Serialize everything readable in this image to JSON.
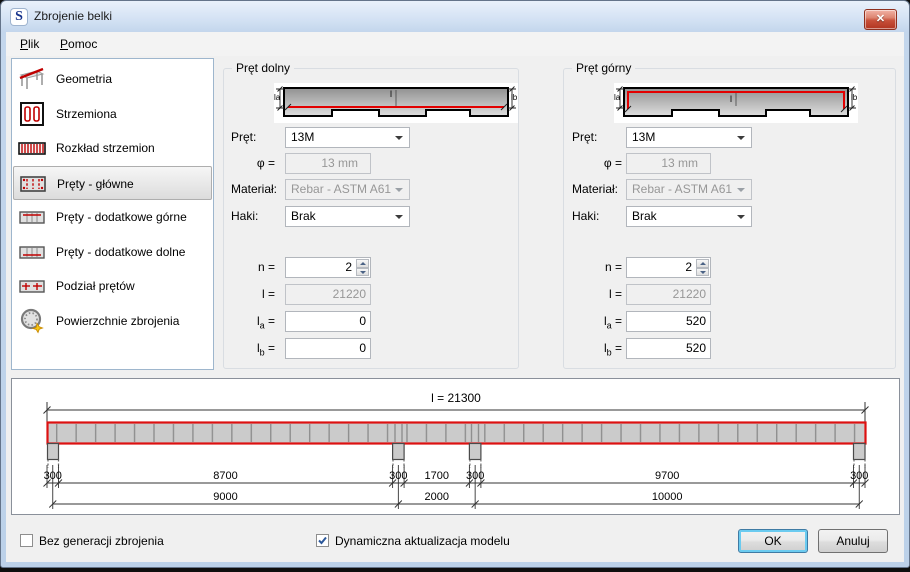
{
  "window": {
    "title": "Zbrojenie belki",
    "app_icon": "S",
    "close_glyph": "✕"
  },
  "menu": {
    "items": [
      {
        "accel": "P",
        "rest": "lik"
      },
      {
        "accel": "P",
        "rest": "omoc"
      }
    ]
  },
  "sidebar": {
    "items": [
      {
        "label": "Geometria",
        "icon": "geometry-icon",
        "selected": false
      },
      {
        "label": "Strzemiona",
        "icon": "stirrups-icon",
        "selected": false
      },
      {
        "label": "Rozkład strzemion",
        "icon": "stirrup-distribution-icon",
        "selected": false
      },
      {
        "label": "Pręty - główne",
        "icon": "main-bars-icon",
        "selected": true
      },
      {
        "label": "Pręty - dodatkowe górne",
        "icon": "additional-top-bars-icon",
        "selected": false
      },
      {
        "label": "Pręty - dodatkowe dolne",
        "icon": "additional-bottom-bars-icon",
        "selected": false
      },
      {
        "label": "Podział prętów",
        "icon": "bar-division-icon",
        "selected": false
      },
      {
        "label": "Powierzchnie zbrojenia",
        "icon": "reinforcement-surfaces-icon",
        "selected": false
      }
    ]
  },
  "groups": {
    "bottom": {
      "title": "Pręt dolny",
      "diagram": {
        "l": "l",
        "la": "la",
        "lb": "lb"
      },
      "rows": {
        "pret_label": "Pręt:",
        "pret_value": "13M",
        "phi_label": "φ =",
        "phi_value": "13 mm",
        "material_label": "Materiał:",
        "material_value": "Rebar - ASTM A61",
        "haki_label": "Haki:",
        "haki_value": "Brak",
        "n_label": "n =",
        "n_value": "2",
        "l_label": "l =",
        "l_value": "21220",
        "la_sym": "l",
        "la_sub": "a",
        "la_eq": "=",
        "la_value": "0",
        "lb_sym": "l",
        "lb_sub": "b",
        "lb_eq": "=",
        "lb_value": "0"
      }
    },
    "top": {
      "title": "Pręt górny",
      "diagram": {
        "l": "l",
        "la": "la",
        "lb": "lb"
      },
      "rows": {
        "pret_label": "Pręt:",
        "pret_value": "13M",
        "phi_label": "φ =",
        "phi_value": "13 mm",
        "material_label": "Materiał:",
        "material_value": "Rebar - ASTM A61",
        "haki_label": "Haki:",
        "haki_value": "Brak",
        "n_label": "n =",
        "n_value": "2",
        "l_label": "l =",
        "l_value": "21220",
        "la_sym": "l",
        "la_sub": "a",
        "la_eq": "=",
        "la_value": "520",
        "lb_sym": "l",
        "lb_sub": "b",
        "lb_eq": "=",
        "lb_value": "520"
      }
    }
  },
  "drawing": {
    "total": "l = 21300",
    "row1": [
      "300",
      "8700",
      "300",
      "1700",
      "300",
      "9700",
      "300"
    ],
    "row2": [
      "9000",
      "2000",
      "10000"
    ]
  },
  "footer": {
    "no_generation_label": "Bez generacji zbrojenia",
    "no_generation_checked": false,
    "dynamic_update_label": "Dynamiczna aktualizacja modelu",
    "dynamic_update_checked": true,
    "ok": "OK",
    "cancel": "Anuluj"
  },
  "colors": {
    "rebar_red": "#dd1111",
    "beam_gray": "#cbcbcb",
    "titlebar_blue": "#bcd1e9"
  }
}
